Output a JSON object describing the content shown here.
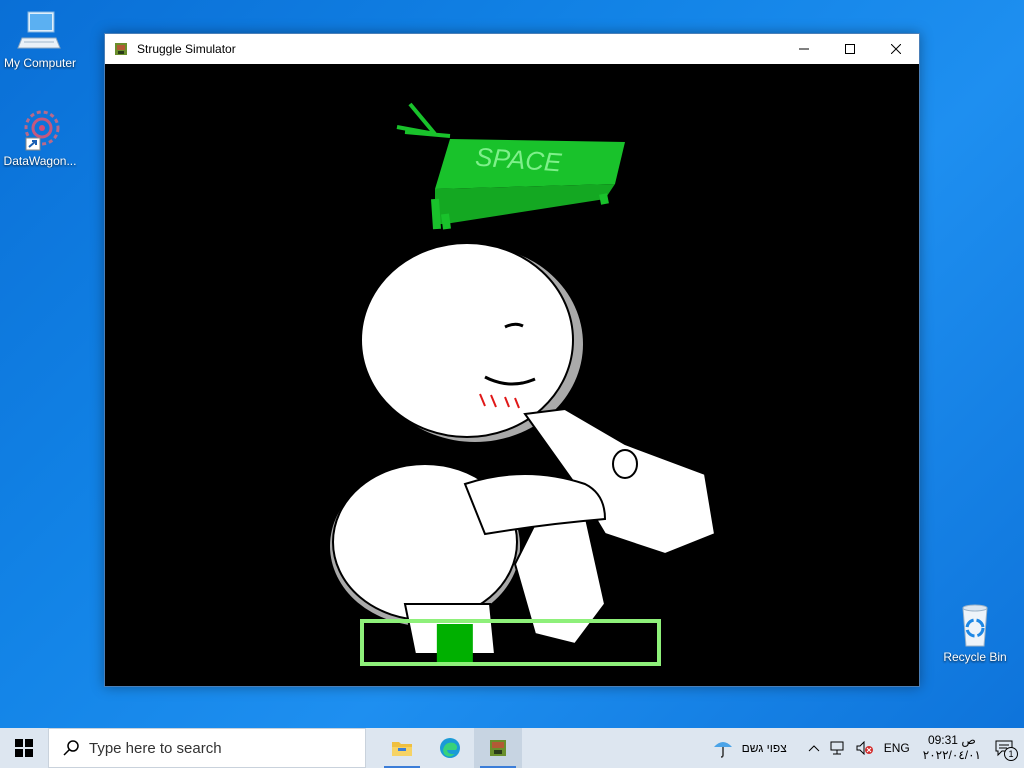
{
  "desktop": {
    "icons": [
      {
        "label": "My Computer"
      },
      {
        "label": "DataWagon..."
      },
      {
        "label": "Recycle Bin"
      }
    ]
  },
  "window": {
    "title": "Struggle Simulator",
    "game": {
      "prompt_key": "SPACE",
      "struggle_meter_level": 0.28,
      "colors": {
        "meter_border": "#8ef07a",
        "meter_fill": "#00b000",
        "key_green": "#19c22b"
      }
    }
  },
  "taskbar": {
    "search_placeholder": "Type here to search",
    "weather_text": "צפוי גשם",
    "language": "ENG",
    "time": "09:31 ص",
    "date": "٢٠٢٢/٠٤/٠١",
    "notification_count": "1"
  },
  "colors": {
    "desktop_blue": "#1283e6",
    "taskbar_bg": "#dde6f0"
  }
}
